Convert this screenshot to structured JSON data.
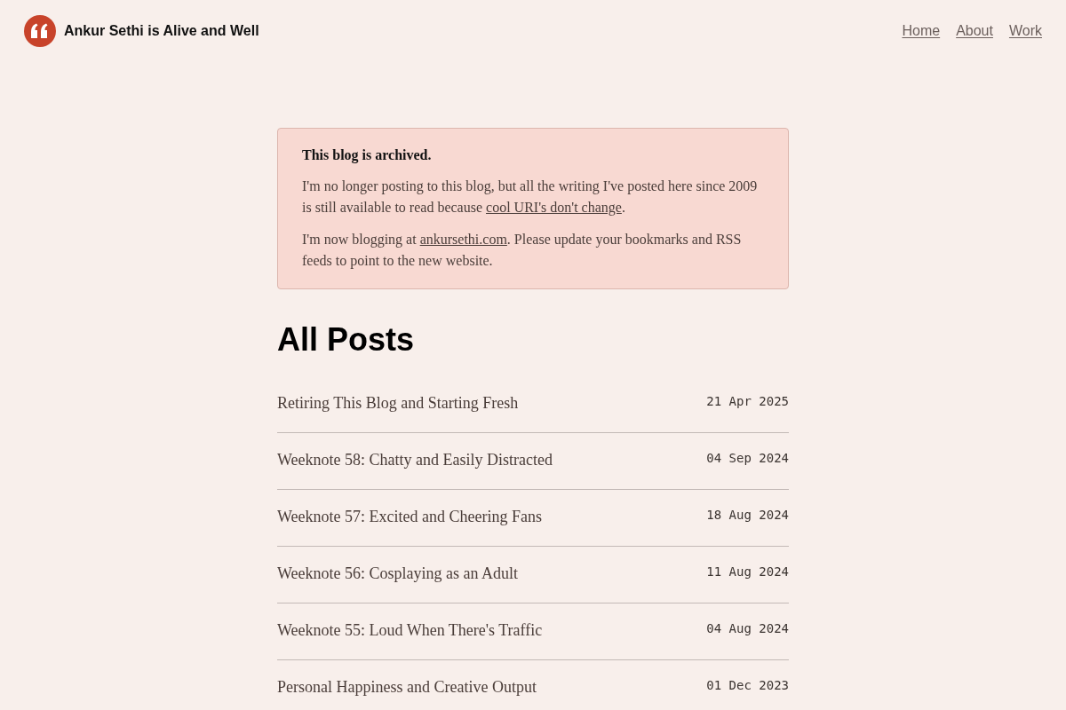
{
  "site": {
    "title": "Ankur Sethi is Alive and Well"
  },
  "nav": [
    {
      "label": "Home"
    },
    {
      "label": "About"
    },
    {
      "label": "Work"
    }
  ],
  "notice": {
    "title": "This blog is archived.",
    "paragraphs": [
      {
        "before": "I'm no longer posting to this blog, but all the writing I've posted here since 2009 is still available to read because ",
        "link": "cool URI's don't change",
        "after": "."
      },
      {
        "before": "I'm now blogging at ",
        "link": "ankursethi.com",
        "after": ". Please update your bookmarks and RSS feeds to point to the new website."
      }
    ]
  },
  "posts_heading": "All Posts",
  "posts": [
    {
      "title": "Retiring This Blog and Starting Fresh",
      "date": "21 Apr 2025"
    },
    {
      "title": "Weeknote 58: Chatty and Easily Distracted",
      "date": "04 Sep 2024"
    },
    {
      "title": "Weeknote 57: Excited and Cheering Fans",
      "date": "18 Aug 2024"
    },
    {
      "title": "Weeknote 56: Cosplaying as an Adult",
      "date": "11 Aug 2024"
    },
    {
      "title": "Weeknote 55: Loud When There's Traffic",
      "date": "04 Aug 2024"
    },
    {
      "title": "Personal Happiness and Creative Output",
      "date": "01 Dec 2023"
    }
  ]
}
